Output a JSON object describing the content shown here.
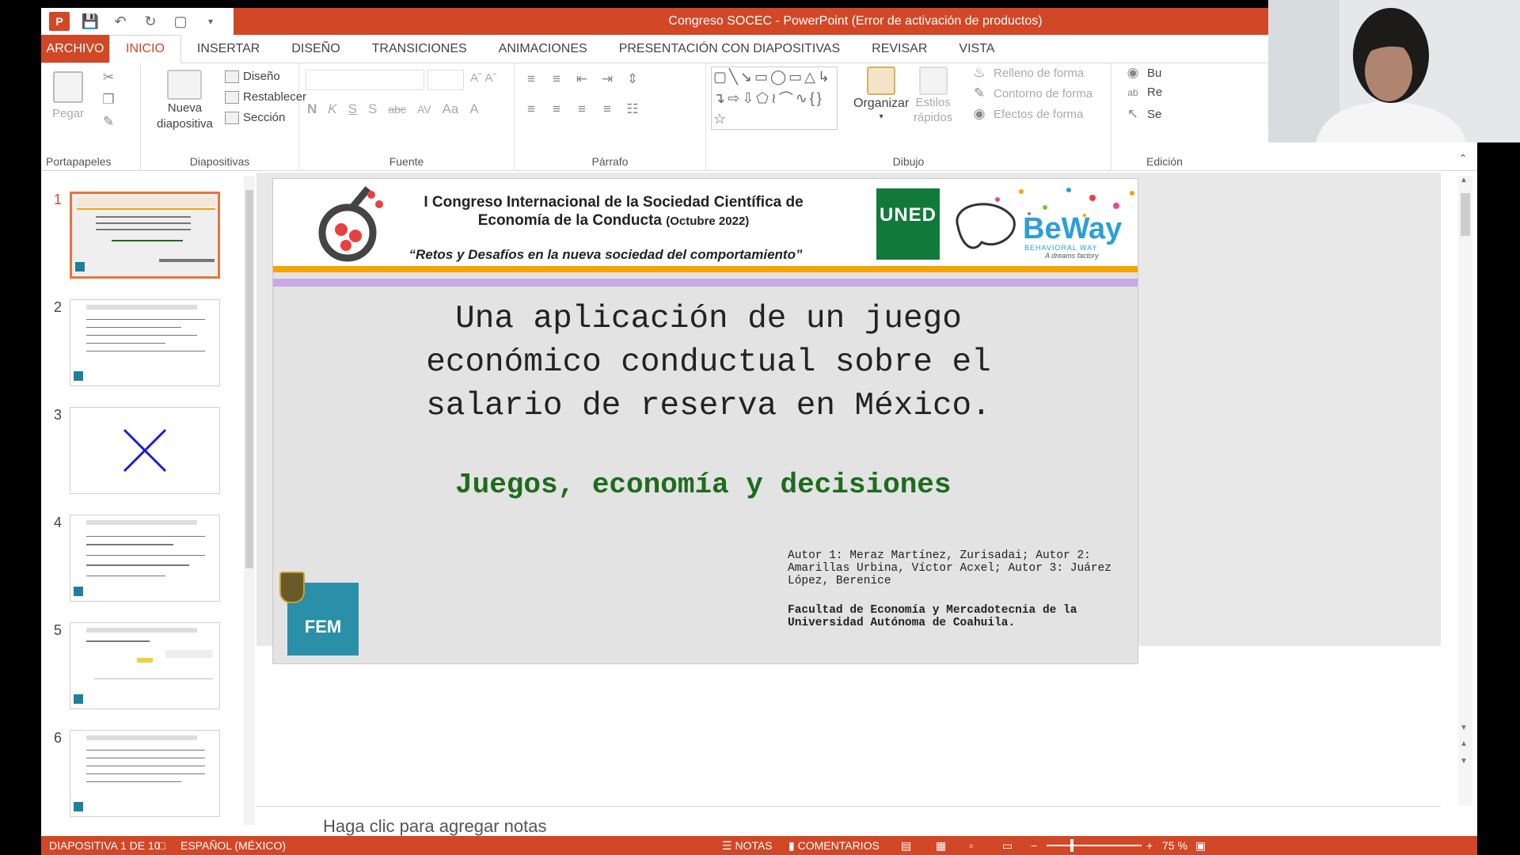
{
  "window": {
    "title": "Congreso SOCEC - PowerPoint (Error de activación de productos)"
  },
  "tabs": [
    {
      "label": "ARCHIVO"
    },
    {
      "label": "INICIO"
    },
    {
      "label": "INSERTAR"
    },
    {
      "label": "DISEÑO"
    },
    {
      "label": "TRANSICIONES"
    },
    {
      "label": "ANIMACIONES"
    },
    {
      "label": "PRESENTACIÓN CON DIAPOSITIVAS"
    },
    {
      "label": "REVISAR"
    },
    {
      "label": "VISTA"
    }
  ],
  "ribbon": {
    "clipboard": {
      "paste": "Pegar",
      "group": "Portapapeles"
    },
    "slides": {
      "new_line1": "Nueva",
      "new_line2": "diapositiva",
      "layout": "Diseño",
      "reset": "Restablecer",
      "section": "Sección",
      "group": "Diapositivas"
    },
    "font": {
      "bold": "N",
      "italic": "K",
      "underline": "S",
      "shadow": "S",
      "strike": "abc",
      "spacing": "AV",
      "case": "Aa",
      "color": "A",
      "group": "Fuente"
    },
    "paragraph": {
      "group": "Párrafo"
    },
    "drawing": {
      "arrange_line1": "Organizar",
      "styles_line1": "Estilos",
      "styles_line2": "rápidos",
      "fill": "Relleno de forma",
      "outline": "Contorno de forma",
      "effects": "Efectos de forma",
      "group": "Dibujo"
    },
    "editing": {
      "find": "Bu",
      "replace": "Re",
      "select": "Se",
      "group": "Edición"
    }
  },
  "thumbnails": [
    {
      "num": "1"
    },
    {
      "num": "2"
    },
    {
      "num": "3"
    },
    {
      "num": "4"
    },
    {
      "num": "5"
    },
    {
      "num": "6"
    }
  ],
  "slide": {
    "conf_title_line1": "I Congreso Internacional de la Sociedad Científica de",
    "conf_title_line2": "Economía de la Conducta",
    "conf_title_date": "(Octubre 2022)",
    "slogan": "“Retos y Desafíos en la nueva sociedad del comportamiento”",
    "uned": "UNED",
    "beway": "BeWay",
    "beway_sub": "BEHAVIORAL WAY",
    "beway_tag": "A dreams factory",
    "title_line1": "Una aplicación de un juego",
    "title_line2": "económico conductual sobre el",
    "title_line3": "salario de reserva en México.",
    "subtitle": "Juegos, economía y decisiones",
    "authors": "Autor 1: Meraz Martínez, Zurisadai; Autor 2: Amarillas Urbina, Víctor Acxel; Autor 3: Juárez López, Berenice",
    "faculty": "Facultad de Economía y Mercadotecnia de la Universidad Autónoma de Coahuila.",
    "fem": "FEM"
  },
  "notes": {
    "placeholder": "Haga clic para agregar notas"
  },
  "status": {
    "slide_info": "DIAPOSITIVA 1 DE 10",
    "language": "ESPAÑOL (MÉXICO)",
    "notes": "NOTAS",
    "comments": "COMENTARIOS",
    "zoom": "75 %"
  },
  "colors": {
    "accent": "#d24726",
    "subtitle_green": "#1e6b1e",
    "uned_green": "#117a3a",
    "beway_blue": "#2b9fd8"
  }
}
